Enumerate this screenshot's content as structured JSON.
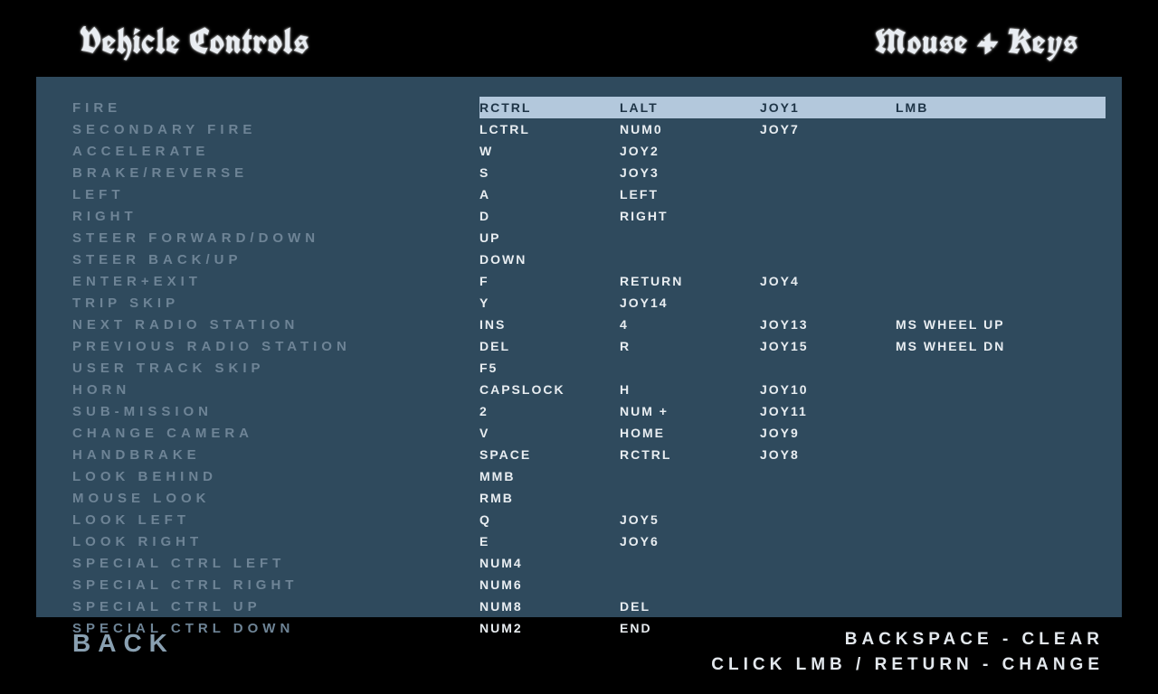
{
  "header": {
    "title_left": "Vehicle Controls",
    "title_right": "Mouse + Keys"
  },
  "bindings": [
    {
      "label": "FIRE",
      "keys": [
        "RCTRL",
        "LALT",
        "JOY1",
        "LMB"
      ],
      "selected": true
    },
    {
      "label": "SECONDARY FIRE",
      "keys": [
        "LCTRL",
        "NUM0",
        "JOY7",
        ""
      ]
    },
    {
      "label": "ACCELERATE",
      "keys": [
        "W",
        "JOY2",
        "",
        ""
      ]
    },
    {
      "label": "BRAKE/REVERSE",
      "keys": [
        "S",
        "JOY3",
        "",
        ""
      ]
    },
    {
      "label": "LEFT",
      "keys": [
        "A",
        "LEFT",
        "",
        ""
      ]
    },
    {
      "label": "RIGHT",
      "keys": [
        "D",
        "RIGHT",
        "",
        ""
      ]
    },
    {
      "label": "STEER FORWARD/DOWN",
      "keys": [
        "UP",
        "",
        "",
        ""
      ]
    },
    {
      "label": "STEER BACK/UP",
      "keys": [
        "DOWN",
        "",
        "",
        ""
      ]
    },
    {
      "label": "ENTER+EXIT",
      "keys": [
        "F",
        "RETURN",
        "JOY4",
        ""
      ]
    },
    {
      "label": "TRIP SKIP",
      "keys": [
        "Y",
        "JOY14",
        "",
        ""
      ]
    },
    {
      "label": "NEXT RADIO STATION",
      "keys": [
        "INS",
        "4",
        "JOY13",
        "MS WHEEL UP"
      ]
    },
    {
      "label": "PREVIOUS RADIO STATION",
      "keys": [
        "DEL",
        "R",
        "JOY15",
        "MS WHEEL DN"
      ]
    },
    {
      "label": "USER TRACK SKIP",
      "keys": [
        "F5",
        "",
        "",
        ""
      ]
    },
    {
      "label": "HORN",
      "keys": [
        "CAPSLOCK",
        "H",
        "JOY10",
        ""
      ]
    },
    {
      "label": "SUB-MISSION",
      "keys": [
        "2",
        "NUM +",
        "JOY11",
        ""
      ]
    },
    {
      "label": "CHANGE CAMERA",
      "keys": [
        "V",
        "HOME",
        "JOY9",
        ""
      ]
    },
    {
      "label": "HANDBRAKE",
      "keys": [
        "SPACE",
        "RCTRL",
        "JOY8",
        ""
      ]
    },
    {
      "label": "LOOK BEHIND",
      "keys": [
        "MMB",
        "",
        "",
        ""
      ]
    },
    {
      "label": "MOUSE LOOK",
      "keys": [
        "RMB",
        "",
        "",
        ""
      ]
    },
    {
      "label": "LOOK LEFT",
      "keys": [
        "Q",
        "JOY5",
        "",
        ""
      ]
    },
    {
      "label": "LOOK RIGHT",
      "keys": [
        "E",
        "JOY6",
        "",
        ""
      ]
    },
    {
      "label": "SPECIAL CTRL LEFT",
      "keys": [
        "NUM4",
        "",
        "",
        ""
      ]
    },
    {
      "label": "SPECIAL CTRL RIGHT",
      "keys": [
        "NUM6",
        "",
        "",
        ""
      ]
    },
    {
      "label": "SPECIAL CTRL UP",
      "keys": [
        "NUM8",
        "DEL",
        "",
        ""
      ]
    },
    {
      "label": "SPECIAL CTRL DOWN",
      "keys": [
        "NUM2",
        "END",
        "",
        ""
      ]
    }
  ],
  "footer": {
    "back": "BACK",
    "hint1": "BACKSPACE - CLEAR",
    "hint2": "CLICK LMB / RETURN - CHANGE"
  }
}
